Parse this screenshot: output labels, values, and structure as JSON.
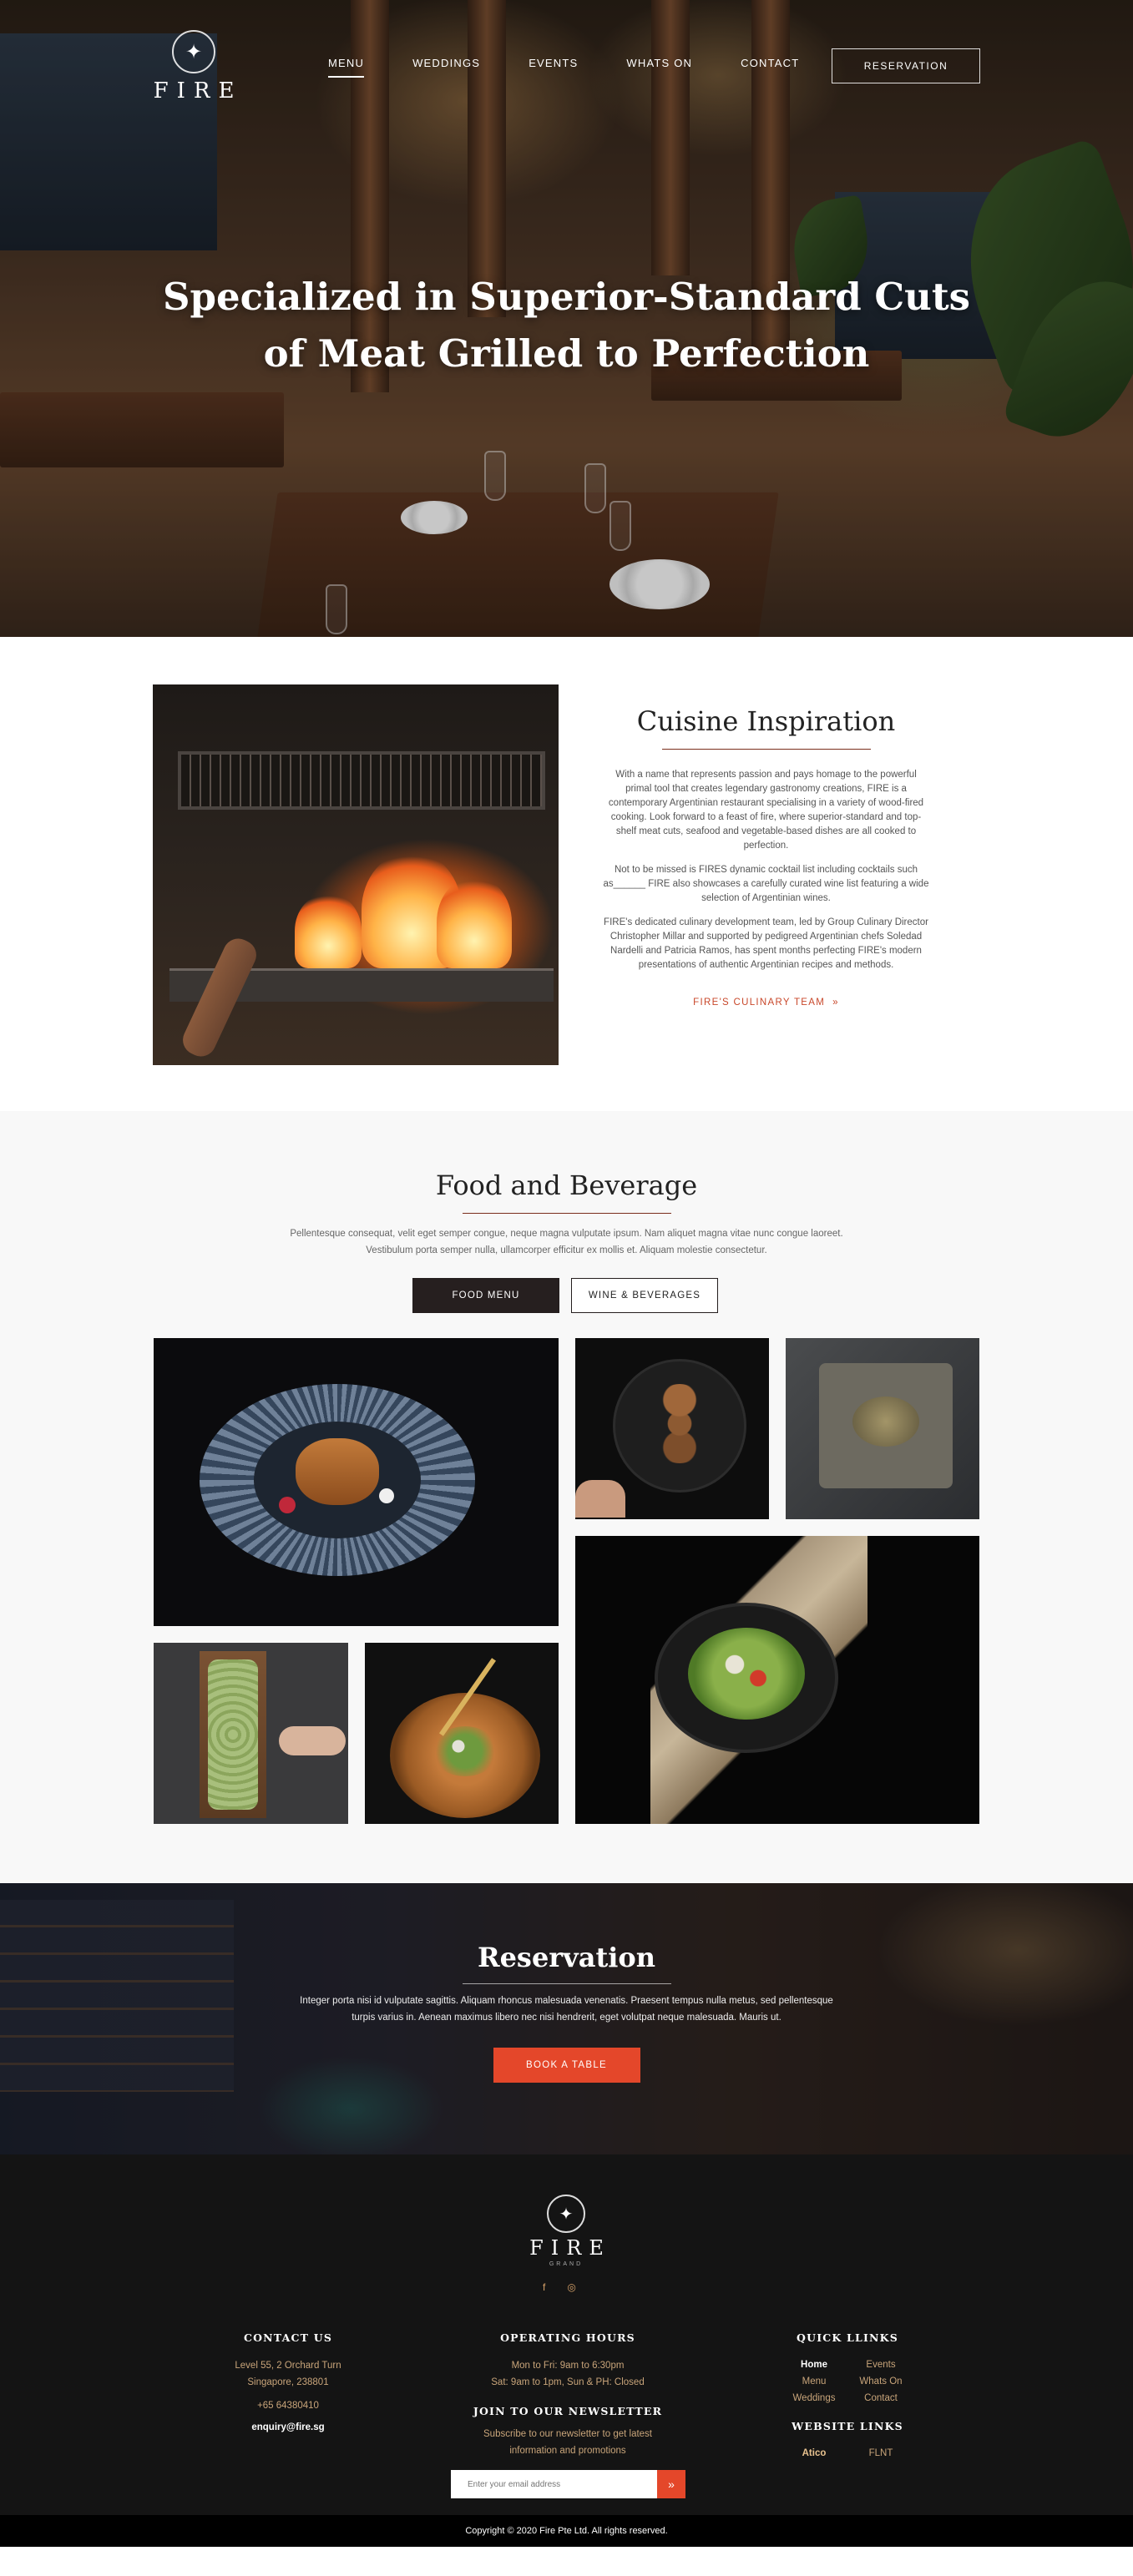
{
  "brand": {
    "name": "FIRE",
    "tagline": "GRAND",
    "logo_icon": "compass-star-icon"
  },
  "nav": {
    "items": [
      "MENU",
      "WEDDINGS",
      "EVENTS",
      "WHATS ON",
      "CONTACT"
    ],
    "active": "MENU",
    "reservation_label": "RESERVATION"
  },
  "hero": {
    "title_line1": "Specialized in Superior-Standard Cuts",
    "title_line2": "of Meat Grilled to Perfection"
  },
  "cuisine": {
    "title": "Cuisine Inspiration",
    "paragraphs": [
      "With a name that represents passion and pays homage to the powerful primal tool that creates legendary gastronomy creations, FIRE is a contemporary Argentinian restaurant specialising in a variety of wood-fired cooking. Look forward to a feast of fire, where superior-standard and top-shelf meat cuts, seafood and vegetable-based dishes are all cooked to perfection.",
      "Not to be missed is FIRES dynamic cocktail list including cocktails such as______ FIRE also showcases a carefully curated wine list featuring a wide selection of Argentinian wines.",
      "FIRE's dedicated culinary development team, led by Group Culinary Director Christopher Millar and supported by pedigreed Argentinian chefs Soledad Nardelli and Patricia Ramos, has spent months perfecting FIRE's modern presentations of authentic Argentinian recipes and methods."
    ],
    "link_label": "FIRE'S CULINARY TEAM",
    "link_icon": "double-chevron-right-icon"
  },
  "fnb": {
    "title": "Food and Beverage",
    "description": "Pellentesque consequat, velit eget semper congue, neque magna vulputate ipsum. Nam aliquet magna vitae nunc congue laoreet. Vestibulum porta semper nulla, ullamcorper efficitur ex mollis et. Aliquam molestie consectetur.",
    "tabs": [
      "FOOD MENU",
      "WINE & BEVERAGES"
    ],
    "active_tab": "FOOD MENU"
  },
  "reservation": {
    "title": "Reservation",
    "description": "Integer porta nisi id vulputate sagittis. Aliquam rhoncus malesuada venenatis. Praesent tempus nulla metus, sed pellentesque turpis varius in. Aenean maximus libero nec nisi hendrerit, eget volutpat neque malesuada. Mauris ut.",
    "button_label": "BOOK A TABLE"
  },
  "footer": {
    "contact": {
      "heading": "CONTACT US",
      "address_line1": "Level 55, 2 Orchard Turn",
      "address_line2": "Singapore, 238801",
      "phone": "+65  64380410",
      "email": "enquiry@fire.sg"
    },
    "hours": {
      "heading": "OPERATING HOURS",
      "line1": "Mon to Fri: 9am to 6:30pm",
      "line2": "Sat: 9am to 1pm, Sun & PH: Closed"
    },
    "newsletter": {
      "heading": "JOIN TO OUR NEWSLETTER",
      "text_line1": "Subscribe to our newsletter to get latest",
      "text_line2": "information and promotions",
      "placeholder": "Enter your email address"
    },
    "quick_links": {
      "heading": "QUICK LLINKS",
      "items": [
        "Home",
        "Events",
        "Menu",
        "Whats On",
        "Weddings",
        "Contact"
      ],
      "current": "Home"
    },
    "website_links": {
      "heading": "WEBSITE LINKS",
      "items": [
        "Atico",
        "FLNT"
      ]
    },
    "social_icons": [
      "facebook-icon",
      "instagram-icon"
    ],
    "copyright": "Copyright © 2020 Fire Pte Ltd. All rights reserved."
  },
  "colors": {
    "accent": "#e4472a",
    "dark": "#261f1f",
    "footer_bg": "#141414",
    "footer_text": "#c9a57a"
  }
}
